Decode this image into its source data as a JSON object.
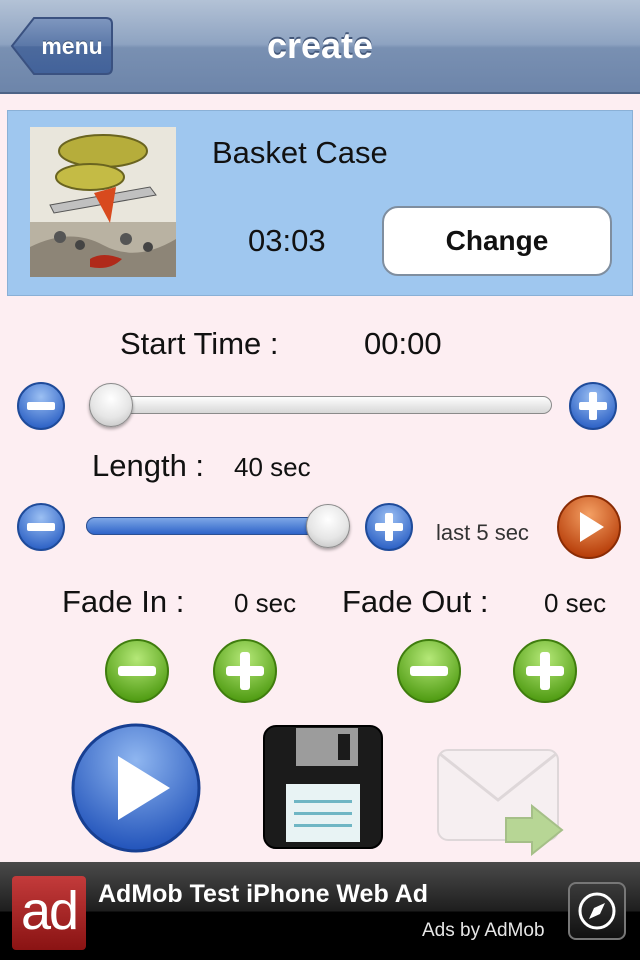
{
  "nav": {
    "back_label": "menu",
    "title": "create"
  },
  "song": {
    "title": "Basket Case",
    "duration": "03:03",
    "change_label": "Change",
    "album_icon": "album-art"
  },
  "start": {
    "label": "Start Time :",
    "value": "00:00",
    "slider_fraction": 0.0
  },
  "length": {
    "label": "Length :",
    "value": "40 sec",
    "slider_fraction": 1.0,
    "preview_label": "last 5 sec"
  },
  "fade_in": {
    "label": "Fade In :",
    "value": "0 sec"
  },
  "fade_out": {
    "label": "Fade Out :",
    "value": "0 sec"
  },
  "actions": {
    "play_icon": "play-icon",
    "save_icon": "floppy-disk-icon",
    "email_icon": "email-forward-icon"
  },
  "ad": {
    "logo_text": "ad",
    "title": "AdMob Test iPhone Web Ad",
    "by": "Ads by AdMob",
    "icon": "compass-icon"
  },
  "colors": {
    "nav": "#7990b2",
    "panel": "#9fc7ef",
    "background": "#fdeef2",
    "blue_button": "#2f64c9",
    "green_button": "#5fae1a",
    "orange_button": "#c9470f"
  }
}
